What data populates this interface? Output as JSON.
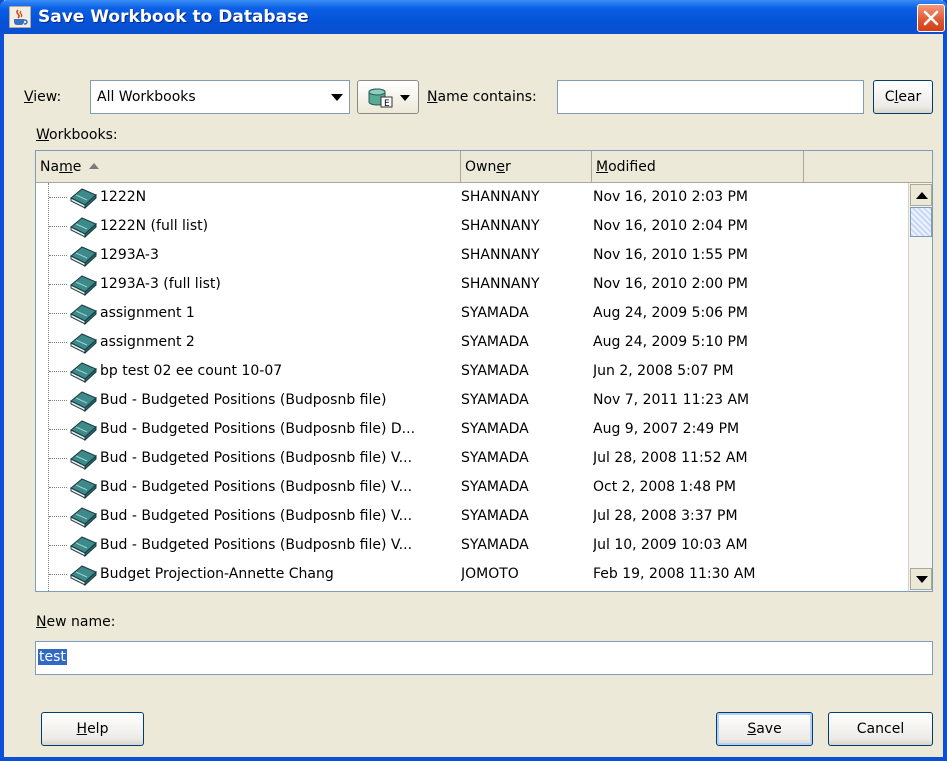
{
  "window": {
    "title": "Save Workbook to Database",
    "icon": "java-cup-icon",
    "close_icon": "close-icon"
  },
  "toolbar": {
    "view_label": "View:",
    "view_mnemonic": "V",
    "view_rest": "iew:",
    "view_selected": "All Workbooks",
    "icon_button_icon": "database-icon",
    "name_contains_mnemonic": "N",
    "name_contains_rest": "ame contains:",
    "name_contains_value": "",
    "clear_label_pre": "C",
    "clear_mnemonic": "l",
    "clear_label_post": "ear"
  },
  "workbooks": {
    "label_mnemonic": "W",
    "label_rest": "orkbooks:",
    "columns": [
      {
        "pre": "Na",
        "mn": "m",
        "post": "e",
        "sort": "ascending"
      },
      {
        "pre": "Own",
        "mn": "e",
        "post": "r"
      },
      {
        "pre": "",
        "mn": "M",
        "post": "odified"
      }
    ],
    "rows": [
      {
        "name": "1222N",
        "owner": "SHANNANY",
        "modified": "Nov 16, 2010 2:03 PM"
      },
      {
        "name": "1222N (full list)",
        "owner": "SHANNANY",
        "modified": "Nov 16, 2010 2:04 PM"
      },
      {
        "name": "1293A-3",
        "owner": "SHANNANY",
        "modified": "Nov 16, 2010 1:55 PM"
      },
      {
        "name": "1293A-3 (full list)",
        "owner": "SHANNANY",
        "modified": "Nov 16, 2010 2:00 PM"
      },
      {
        "name": "assignment 1",
        "owner": "SYAMADA",
        "modified": "Aug 24, 2009 5:06 PM"
      },
      {
        "name": "assignment 2",
        "owner": "SYAMADA",
        "modified": "Aug 24, 2009 5:10 PM"
      },
      {
        "name": "bp test 02 ee count 10-07",
        "owner": "SYAMADA",
        "modified": "Jun 2, 2008 5:07 PM"
      },
      {
        "name": "Bud - Budgeted Positions (Budposnb file)",
        "owner": "SYAMADA",
        "modified": "Nov 7, 2011 11:23 AM"
      },
      {
        "name": "Bud - Budgeted Positions (Budposnb file) D...",
        "owner": "SYAMADA",
        "modified": "Aug 9, 2007 2:49 PM"
      },
      {
        "name": "Bud - Budgeted Positions (Budposnb file) V...",
        "owner": "SYAMADA",
        "modified": "Jul 28, 2008 11:52 AM"
      },
      {
        "name": "Bud - Budgeted Positions (Budposnb file) V...",
        "owner": "SYAMADA",
        "modified": "Oct 2, 2008 1:48 PM"
      },
      {
        "name": "Bud - Budgeted Positions (Budposnb file) V...",
        "owner": "SYAMADA",
        "modified": "Jul 28, 2008 3:37 PM"
      },
      {
        "name": "Bud - Budgeted Positions (Budposnb file) V...",
        "owner": "SYAMADA",
        "modified": "Jul 10, 2009 10:03 AM"
      },
      {
        "name": "Budget Projection-Annette Chang",
        "owner": "JOMOTO",
        "modified": "Feb 19, 2008 11:30 AM"
      }
    ]
  },
  "new_name": {
    "label_mnemonic": "N",
    "label_rest": "ew name:",
    "value": "test"
  },
  "buttons": {
    "help_mnemonic": "H",
    "help_rest": "elp",
    "save_mnemonic": "S",
    "save_rest": "ave",
    "cancel_label": "Cancel"
  },
  "colors": {
    "titlebar": "#0a5fe6",
    "dialog_bg": "#ece9d8",
    "selection": "#316ac5"
  }
}
